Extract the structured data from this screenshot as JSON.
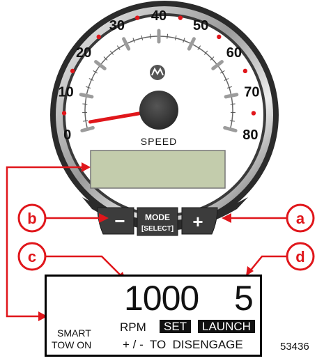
{
  "gauge": {
    "ticks": [
      "0",
      "10",
      "20",
      "30",
      "40",
      "50",
      "60",
      "70",
      "80"
    ],
    "unit_label": "SPEED",
    "needle_value": 2,
    "max_value": 80,
    "colors": {
      "bezel_dark": "#2b2b2b",
      "bezel_light": "#d8d8d8",
      "dial_face": "#ffffff",
      "needle": "#e0161b",
      "red_dot": "#e0161b",
      "hub": "#444444",
      "lcd": "#c3ccac",
      "callout": "#e0161b"
    }
  },
  "buttons": {
    "minus": "−",
    "mode_line1": "MODE",
    "mode_line2": "[SELECT]",
    "plus": "+"
  },
  "callouts": {
    "a": "a",
    "b": "b",
    "c": "c",
    "d": "d"
  },
  "display": {
    "rpm_value": "1000",
    "launch_value": "5",
    "rpm_label": "RPM",
    "set_label": "SET",
    "launch_label": "LAUNCH",
    "smart_line1": "SMART",
    "smart_line2": "TOW ON",
    "instruction": "+ / -  TO  DISENGAGE"
  },
  "figure_id": "53436"
}
